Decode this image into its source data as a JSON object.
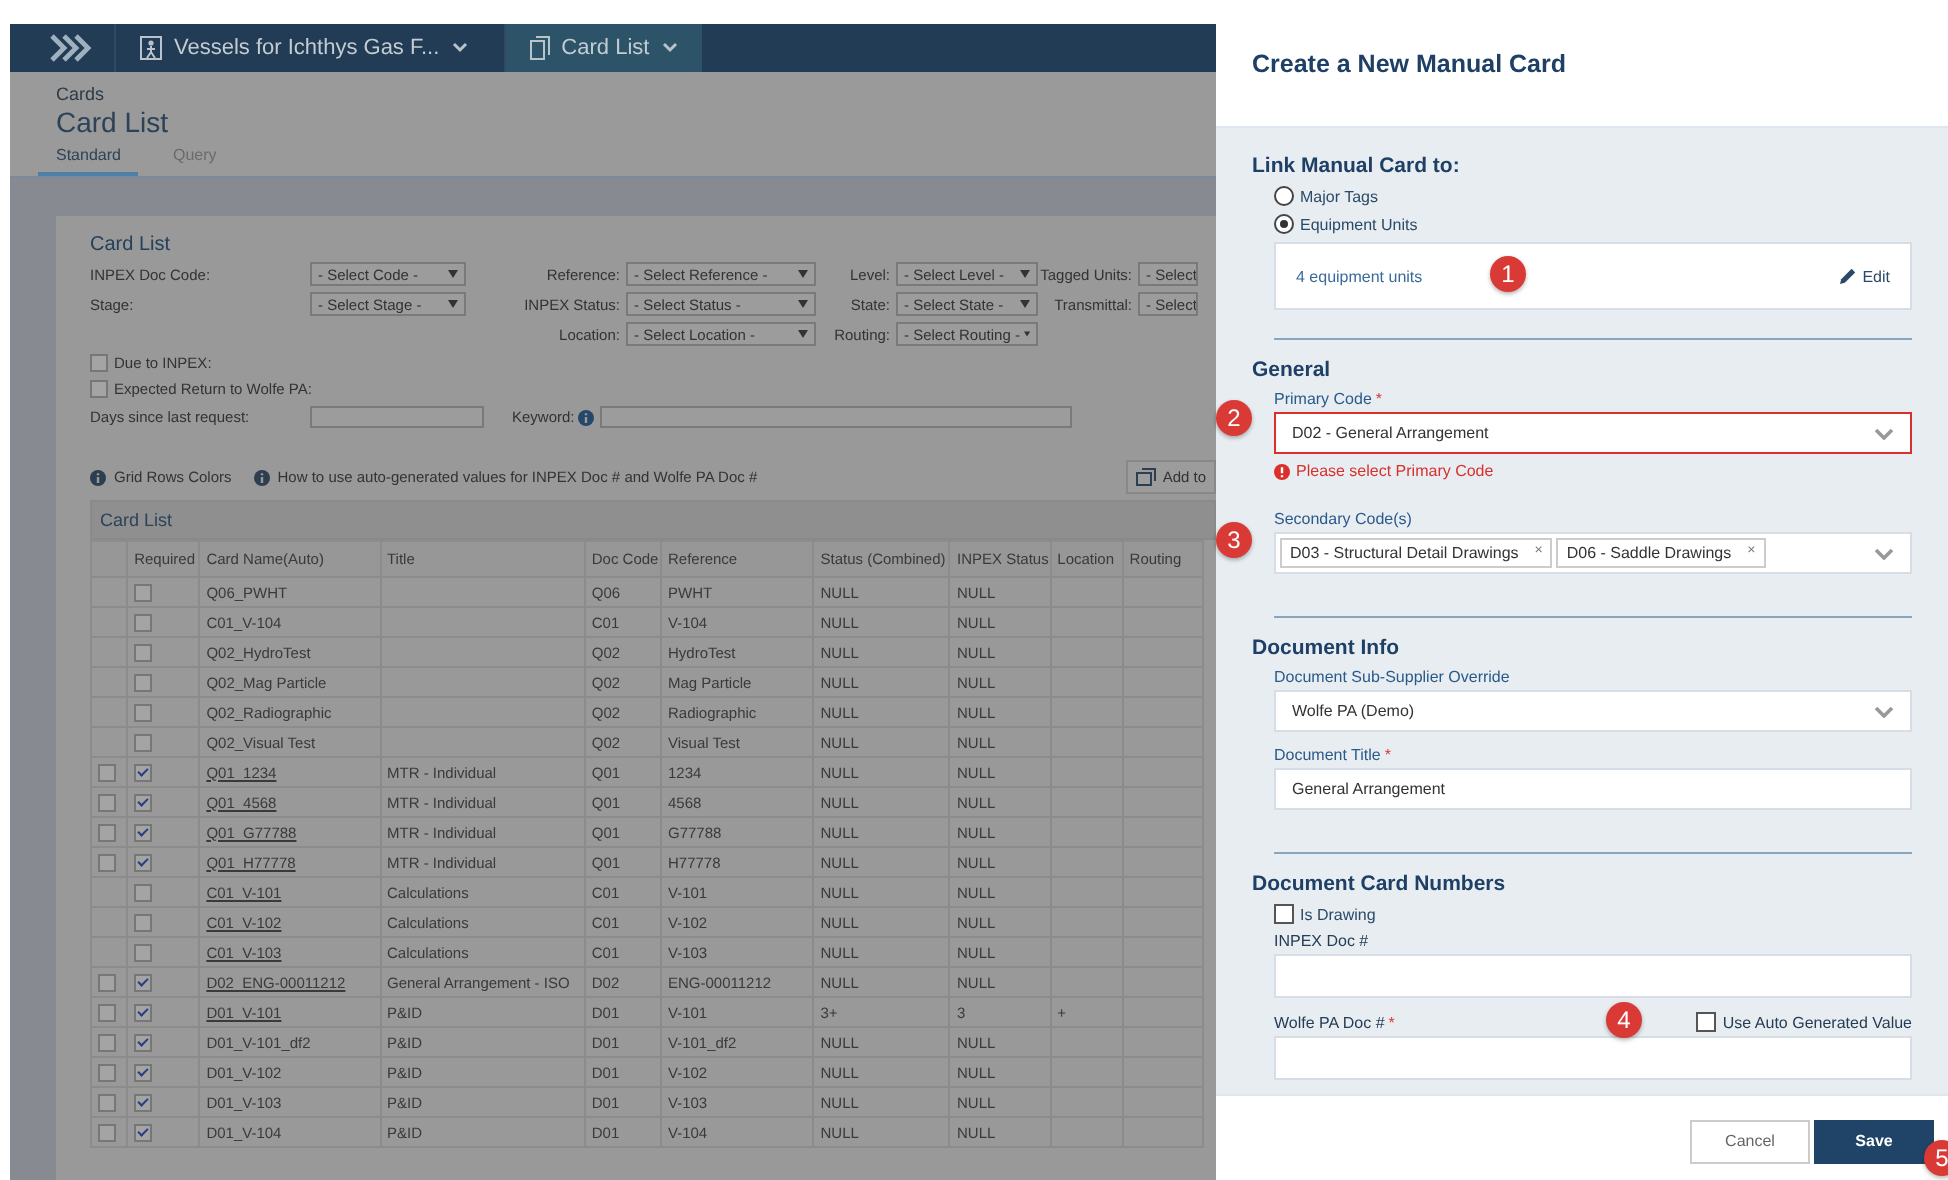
{
  "breadcrumbs": [
    {
      "label": "Vessels for Ichthys Gas F...",
      "active": false
    },
    {
      "label": "Card List",
      "active": true
    }
  ],
  "page": {
    "overline": "Cards",
    "title": "Card List"
  },
  "tabs": [
    {
      "label": "Standard",
      "selected": true
    },
    {
      "label": "Query",
      "selected": false
    }
  ],
  "card_title": "Card List",
  "filters": [
    [
      {
        "label": "INPEX Doc Code:",
        "value": "- Select Code -"
      },
      {
        "label": "Reference:",
        "value": "- Select Reference -"
      },
      {
        "label": "Level:",
        "value": "- Select Level -"
      },
      {
        "label": "Tagged Units:",
        "value": "- Select"
      }
    ],
    [
      {
        "label": "Stage:",
        "value": "- Select Stage -"
      },
      {
        "label": "INPEX Status:",
        "value": "- Select Status -"
      },
      {
        "label": "State:",
        "value": "- Select State -"
      },
      {
        "label": "Transmittal:",
        "value": "- Select"
      }
    ],
    [
      {
        "label": "Location:",
        "value": "- Select Location -"
      },
      {
        "label": "Routing:",
        "value": "- Select Routing -"
      }
    ]
  ],
  "filter_checks": [
    {
      "label": "Due to INPEX:",
      "checked": false
    },
    {
      "label": "Expected Return to Wolfe PA:",
      "checked": false
    }
  ],
  "days_label": "Days since last request:",
  "keyword_label": "Keyword:",
  "help_links": [
    "Grid Rows Colors",
    "How to use auto-generated values for INPEX Doc # and Wolfe PA Doc #"
  ],
  "add_button": "Add to",
  "grid": {
    "title": "Card List",
    "columns": [
      "Required",
      "Card Name(Auto)",
      "Title",
      "Doc Code",
      "Reference",
      "Status (Combined)",
      "INPEX Status",
      "Location",
      "Routing"
    ],
    "rows": [
      {
        "selectable": false,
        "selected": false,
        "required": false,
        "link": false,
        "card_name": "Q06_PWHT",
        "doc_code": "Q06",
        "reference": "PWHT",
        "status": "NULL",
        "inpex_status": "NULL"
      },
      {
        "selectable": false,
        "selected": false,
        "required": false,
        "link": false,
        "card_name": "C01_V-104",
        "doc_code": "C01",
        "reference": "V-104",
        "status": "NULL",
        "inpex_status": "NULL"
      },
      {
        "selectable": false,
        "selected": false,
        "required": false,
        "link": false,
        "card_name": "Q02_HydroTest",
        "doc_code": "Q02",
        "reference": "HydroTest",
        "status": "NULL",
        "inpex_status": "NULL"
      },
      {
        "selectable": false,
        "selected": false,
        "required": false,
        "link": false,
        "card_name": "Q02_Mag Particle",
        "doc_code": "Q02",
        "reference": "Mag Particle",
        "status": "NULL",
        "inpex_status": "NULL"
      },
      {
        "selectable": false,
        "selected": false,
        "required": false,
        "link": false,
        "card_name": "Q02_Radiographic",
        "doc_code": "Q02",
        "reference": "Radiographic",
        "status": "NULL",
        "inpex_status": "NULL"
      },
      {
        "selectable": false,
        "selected": false,
        "required": false,
        "link": false,
        "card_name": "Q02_Visual Test",
        "doc_code": "Q02",
        "reference": "Visual Test",
        "status": "NULL",
        "inpex_status": "NULL"
      },
      {
        "selectable": true,
        "selected": false,
        "required": true,
        "link": true,
        "card_name": "Q01_1234",
        "title": "MTR - Individual",
        "doc_code": "Q01",
        "reference": "1234",
        "status": "NULL",
        "inpex_status": "NULL"
      },
      {
        "selectable": true,
        "selected": false,
        "required": true,
        "link": true,
        "card_name": "Q01_4568",
        "title": "MTR - Individual",
        "doc_code": "Q01",
        "reference": "4568",
        "status": "NULL",
        "inpex_status": "NULL"
      },
      {
        "selectable": true,
        "selected": false,
        "required": true,
        "link": true,
        "card_name": "Q01_G77788",
        "title": "MTR - Individual",
        "doc_code": "Q01",
        "reference": "G77788",
        "status": "NULL",
        "inpex_status": "NULL"
      },
      {
        "selectable": true,
        "selected": false,
        "required": true,
        "link": true,
        "card_name": "Q01_H77778",
        "title": "MTR - Individual",
        "doc_code": "Q01",
        "reference": "H77778",
        "status": "NULL",
        "inpex_status": "NULL"
      },
      {
        "selectable": false,
        "selected": false,
        "required": false,
        "link": true,
        "card_name": "C01_V-101",
        "title": "Calculations",
        "doc_code": "C01",
        "reference": "V-101",
        "status": "NULL",
        "inpex_status": "NULL"
      },
      {
        "selectable": false,
        "selected": false,
        "required": false,
        "link": true,
        "card_name": "C01_V-102",
        "title": "Calculations",
        "doc_code": "C01",
        "reference": "V-102",
        "status": "NULL",
        "inpex_status": "NULL"
      },
      {
        "selectable": false,
        "selected": false,
        "required": false,
        "link": true,
        "card_name": "C01_V-103",
        "title": "Calculations",
        "doc_code": "C01",
        "reference": "V-103",
        "status": "NULL",
        "inpex_status": "NULL"
      },
      {
        "selectable": true,
        "selected": false,
        "required": true,
        "link": true,
        "card_name": "D02_ENG-00011212",
        "title": "General Arrangement - ISO",
        "doc_code": "D02",
        "reference": "ENG-00011212",
        "status": "NULL",
        "inpex_status": "NULL"
      },
      {
        "selectable": true,
        "selected": false,
        "required": true,
        "link": true,
        "card_name": "D01_V-101",
        "title": "P&ID",
        "doc_code": "D01",
        "reference": "V-101",
        "status": "3+",
        "inpex_status": "3",
        "location": "+"
      },
      {
        "selectable": true,
        "selected": false,
        "required": true,
        "link": false,
        "card_name": "D01_V-101_df2",
        "title": "P&ID",
        "doc_code": "D01",
        "reference": "V-101_df2",
        "status": "NULL",
        "inpex_status": "NULL"
      },
      {
        "selectable": true,
        "selected": false,
        "required": true,
        "link": false,
        "card_name": "D01_V-102",
        "title": "P&ID",
        "doc_code": "D01",
        "reference": "V-102",
        "status": "NULL",
        "inpex_status": "NULL"
      },
      {
        "selectable": true,
        "selected": false,
        "required": true,
        "link": false,
        "card_name": "D01_V-103",
        "title": "P&ID",
        "doc_code": "D01",
        "reference": "V-103",
        "status": "NULL",
        "inpex_status": "NULL"
      },
      {
        "selectable": true,
        "selected": false,
        "required": true,
        "link": false,
        "card_name": "D01_V-104",
        "title": "P&ID",
        "doc_code": "D01",
        "reference": "V-104",
        "status": "NULL",
        "inpex_status": "NULL"
      }
    ]
  },
  "panel": {
    "title": "Create a New Manual Card",
    "link_heading": "Link Manual Card to:",
    "link_options": [
      {
        "label": "Major Tags",
        "selected": false
      },
      {
        "label": "Equipment Units",
        "selected": true
      }
    ],
    "units_link": "4 equipment units",
    "edit_label": "Edit",
    "general_heading": "General",
    "primary": {
      "label": "Primary Code",
      "required_mark": "*",
      "value": "D02 - General Arrangement",
      "error": "Please select Primary Code"
    },
    "secondary": {
      "label": "Secondary Code(s)",
      "tags": [
        "D03 - Structural Detail Drawings",
        "D06 - Saddle Drawings"
      ],
      "remove": "×"
    },
    "docinfo_heading": "Document Info",
    "supplier": {
      "label": "Document Sub-Supplier Override",
      "value": "Wolfe PA (Demo)"
    },
    "doc_title": {
      "label": "Document Title",
      "required_mark": "*",
      "value": "General Arrangement"
    },
    "numbers_heading": "Document Card Numbers",
    "is_drawing": {
      "label": "Is Drawing",
      "checked": false
    },
    "inpex_doc": {
      "label": "INPEX Doc #"
    },
    "wolfe_doc": {
      "label": "Wolfe PA Doc #",
      "required_mark": "*"
    },
    "auto_value": {
      "label": "Use Auto Generated Value",
      "checked": false
    },
    "cancel": "Cancel",
    "save": "Save"
  },
  "badges": [
    "1",
    "2",
    "3",
    "4",
    "5"
  ]
}
